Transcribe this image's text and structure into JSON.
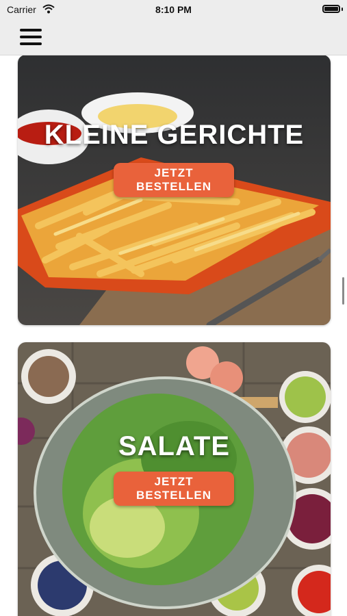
{
  "status_bar": {
    "carrier": "Carrier",
    "time": "8:10 PM",
    "wifi_icon": "wifi-icon",
    "battery_icon": "battery-icon"
  },
  "navbar": {
    "menu_icon": "hamburger-menu-icon"
  },
  "categories": [
    {
      "title": "KLEINE GERICHTE",
      "button_label": "JETZT BESTELLEN",
      "image": "french-fries-photo"
    },
    {
      "title": "SALATE",
      "button_label": "JETZT BESTELLEN",
      "image": "salad-bowl-photo"
    }
  ],
  "colors": {
    "accent": "#e9623b",
    "bar_background": "#ededed"
  }
}
